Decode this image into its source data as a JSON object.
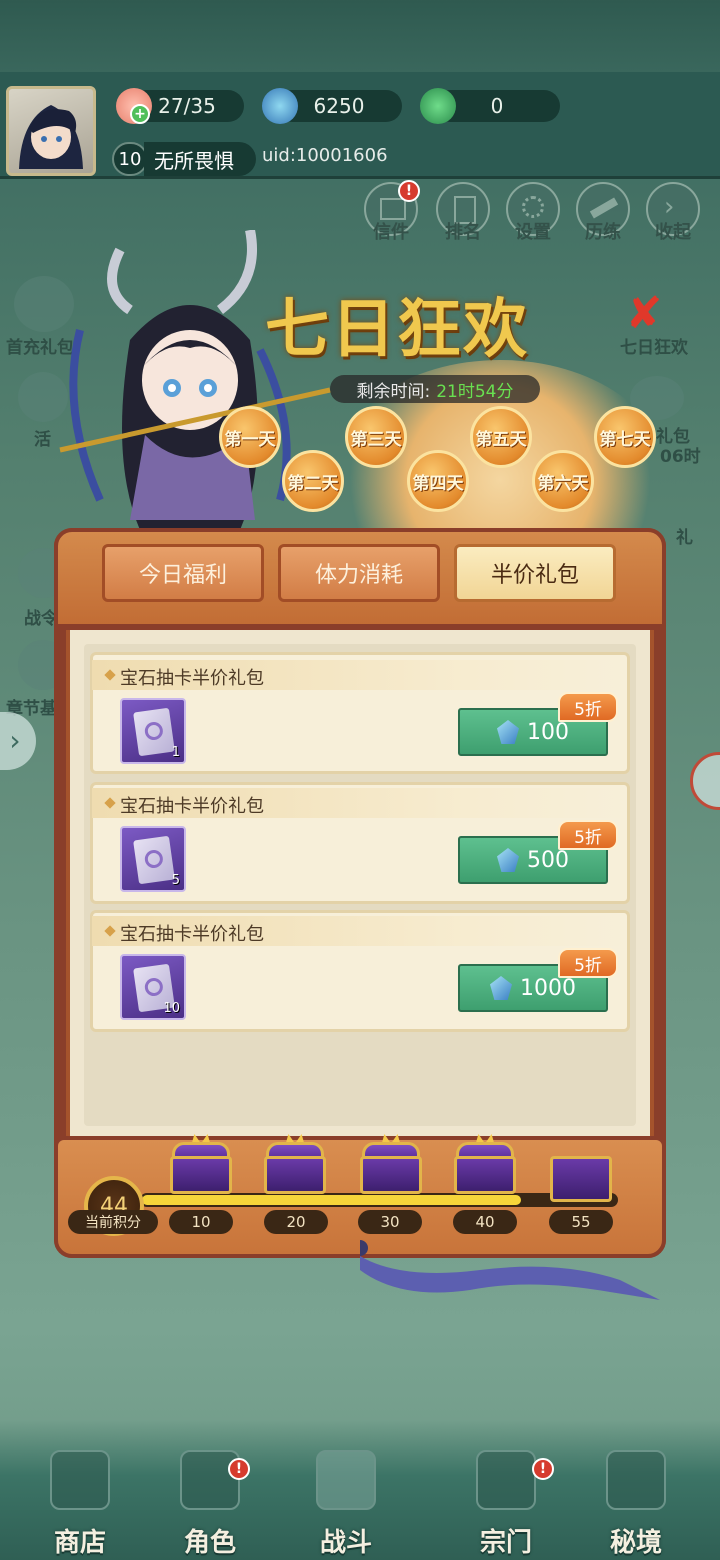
{
  "resources": {
    "stamina": "27/35",
    "gems": "6250",
    "jade": "0"
  },
  "player": {
    "level": "10",
    "name": "无所畏惧",
    "uid": "uid:10001606"
  },
  "top_menu": [
    {
      "label": "信件",
      "icon": "mail-icon",
      "badge": "!"
    },
    {
      "label": "排名",
      "icon": "ranking-icon"
    },
    {
      "label": "设置",
      "icon": "gear-icon"
    },
    {
      "label": "历练",
      "icon": "training-icon"
    },
    {
      "label": "收起",
      "icon": "chevron-right-icon"
    }
  ],
  "left_menu": [
    {
      "label": "首充礼包",
      "icon": "gift-bag-icon"
    },
    {
      "label": "活",
      "icon": "activity-icon"
    },
    {
      "label": "战令",
      "icon": "battle-pass-icon"
    },
    {
      "label": "章节基",
      "icon": "chapter-fund-icon"
    }
  ],
  "right_menu": [
    {
      "label": "七日狂欢",
      "icon": "seven-day-icon"
    },
    {
      "label": "礼包",
      "sub": "06时",
      "icon": "gift-icon"
    },
    {
      "label": "礼",
      "icon": "gift2-icon"
    }
  ],
  "event": {
    "title": "七日狂欢",
    "timer_label": "剩余时间:",
    "timer_value": "21时54分",
    "days": [
      "第一天",
      "第二天",
      "第三天",
      "第四天",
      "第五天",
      "第六天",
      "第七天"
    ]
  },
  "tabs": {
    "t1": "今日福利",
    "t2": "体力消耗",
    "t3": "半价礼包",
    "active": "半价礼包"
  },
  "packages": [
    {
      "title": "宝石抽卡半价礼包",
      "qty": "1",
      "price": "100",
      "discount": "5折"
    },
    {
      "title": "宝石抽卡半价礼包",
      "qty": "5",
      "price": "500",
      "discount": "5折"
    },
    {
      "title": "宝石抽卡半价礼包",
      "qty": "10",
      "price": "1000",
      "discount": "5折"
    }
  ],
  "progress": {
    "score": "44",
    "score_label": "当前积分",
    "score_value": 44,
    "max": 55,
    "milestones": [
      "10",
      "20",
      "30",
      "40",
      "55"
    ]
  },
  "bottom_nav": [
    {
      "label": "商店",
      "icon": "shop-icon"
    },
    {
      "label": "角色",
      "icon": "character-icon",
      "badge": "!"
    },
    {
      "label": "战斗",
      "icon": "battle-icon"
    },
    {
      "label": "宗门",
      "icon": "sect-icon",
      "badge": "!"
    },
    {
      "label": "秘境",
      "icon": "secret-realm-icon"
    }
  ],
  "colors": {
    "accent_orange": "#e38a2c",
    "buy_green": "#4caf7d",
    "timer_green": "#69e051",
    "discount": "#e06a24"
  }
}
